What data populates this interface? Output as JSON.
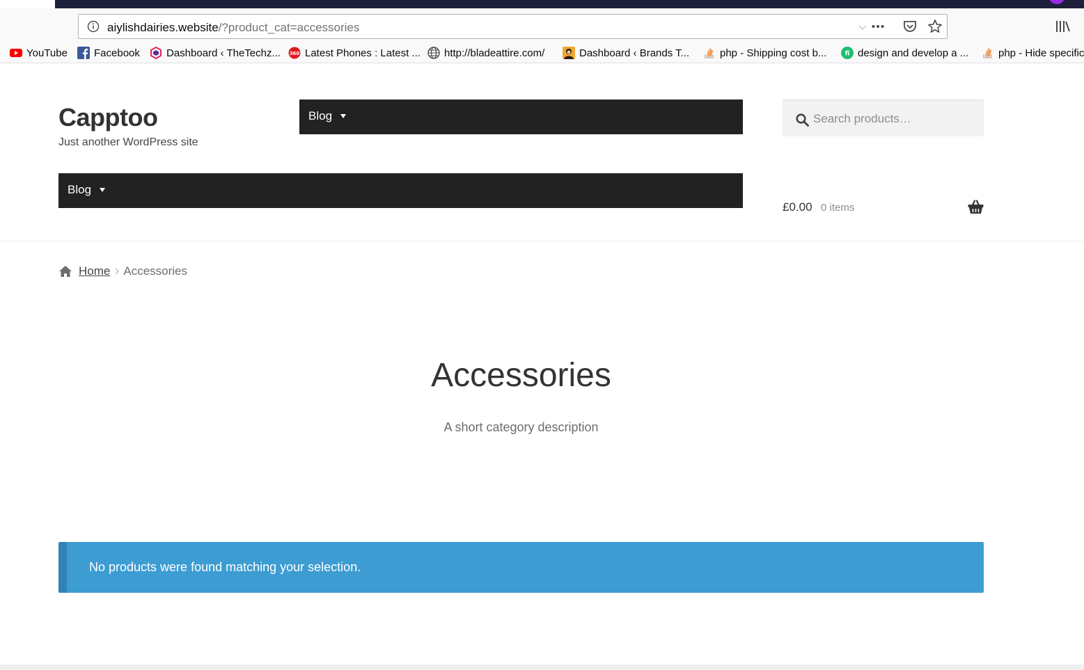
{
  "browser": {
    "url_host": "aiylishdairies.website",
    "url_path": "/?product_cat=accessories",
    "icons": [
      "info-icon",
      "chevron-down-icon",
      "more-icon",
      "pocket-icon",
      "star-icon",
      "library-icon"
    ],
    "colors": {
      "titlebar": "#1e1f3b",
      "avatar": "#9a2be0"
    },
    "bookmarks": [
      {
        "label": "YouTube",
        "icon": "youtube-icon"
      },
      {
        "label": "Facebook",
        "icon": "facebook-icon"
      },
      {
        "label": "Dashboard ‹ TheTechz...",
        "icon": "hexagon-logo-icon"
      },
      {
        "label": "Latest Phones : Latest ...",
        "icon": "360-logo-icon"
      },
      {
        "label": "http://bladeattire.com/",
        "icon": "globe-icon"
      },
      {
        "label": "Dashboard ‹ Brands T...",
        "icon": "avatar-icon"
      },
      {
        "label": "php - Shipping cost b...",
        "icon": "stackoverflow-icon"
      },
      {
        "label": "design and develop a ...",
        "icon": "fiverr-icon"
      },
      {
        "label": "php - Hide specific",
        "icon": "stackoverflow-icon"
      }
    ]
  },
  "site": {
    "title": "Capptoo",
    "description": "Just another WordPress site"
  },
  "nav": {
    "top_item": "Blog",
    "main_item": "Blog"
  },
  "search": {
    "placeholder": "Search products…"
  },
  "cart": {
    "amount": "£0.00",
    "count": "0 items"
  },
  "breadcrumb": {
    "home": "Home",
    "current": "Accessories"
  },
  "category": {
    "title": "Accessories",
    "description": "A short category description"
  },
  "notice": {
    "message": "No products were found matching your selection.",
    "color": "#3d9cd2",
    "border_color": "#2e83b8"
  }
}
